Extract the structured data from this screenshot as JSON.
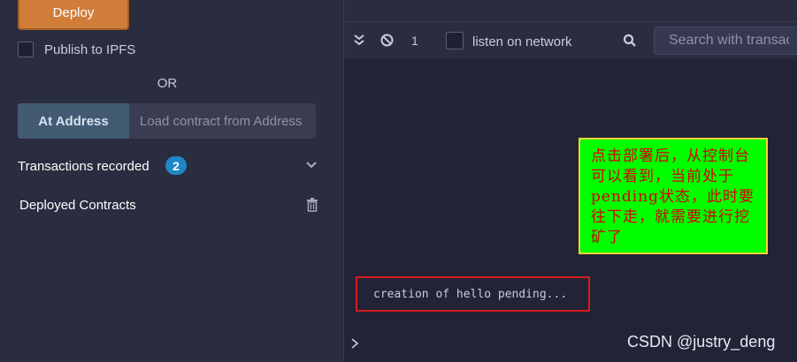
{
  "deploy": {
    "button_label": "Deploy",
    "publish_label": "Publish to IPFS",
    "or_text": "OR",
    "at_address_label": "At Address",
    "address_placeholder": "Load contract from Address"
  },
  "transactions": {
    "label": "Transactions recorded",
    "count": "2"
  },
  "deployed": {
    "label": "Deployed Contracts"
  },
  "terminal": {
    "pending_count": "1",
    "listen_label": "listen on network",
    "search_placeholder": "Search with transaction hash or address",
    "log_line": "creation of hello pending...",
    "note_text": "点击部署后，从控制台可以看到，当前处于pending状态，此时要往下走，就需要进行挖矿了"
  },
  "watermark": "CSDN @justry_deng",
  "colors": {
    "deploy_button": "#d07d3a",
    "badge": "#1e87c7",
    "note_background": "#00ff00",
    "note_text": "#d40000",
    "highlight_border": "#d41c1c"
  }
}
